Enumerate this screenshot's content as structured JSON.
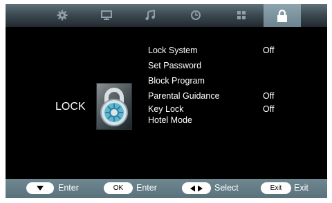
{
  "tabs": [
    {
      "icon": "gear-icon",
      "active": false
    },
    {
      "icon": "monitor-icon",
      "active": false
    },
    {
      "icon": "music-note-icon",
      "active": false
    },
    {
      "icon": "clock-icon",
      "active": false
    },
    {
      "icon": "grid-icon",
      "active": false
    },
    {
      "icon": "lock-icon",
      "active": true
    }
  ],
  "page": {
    "title": "LOCK",
    "emblem_icon": "padlock-emblem-icon"
  },
  "menu": [
    {
      "label": "Lock System",
      "value": "Off"
    },
    {
      "label": "Set Password",
      "value": ""
    },
    {
      "label": "Block Program",
      "value": ""
    },
    {
      "label": "Parental Guidance",
      "value": "Off"
    },
    {
      "label": "Key Lock",
      "value": "Off"
    },
    {
      "label": "Hotel Mode",
      "value": ""
    }
  ],
  "hints": [
    {
      "key_icon": "down-arrow-icon",
      "key_text": "",
      "action": "Enter"
    },
    {
      "key_icon": "",
      "key_text": "OK",
      "action": "Enter"
    },
    {
      "key_icon": "left-right-arrows-icon",
      "key_text": "",
      "action": "Select"
    },
    {
      "key_icon": "",
      "key_text": "Exit",
      "action": "Exit"
    }
  ],
  "colors": {
    "background": "#000000",
    "bar": "#5a727c",
    "text": "#ffffff",
    "active_tab": "#7f96a1"
  }
}
